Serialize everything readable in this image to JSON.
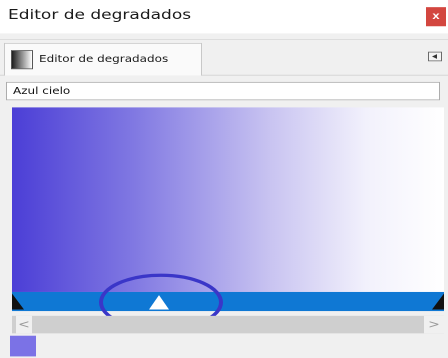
{
  "window": {
    "title": "Editor de degradados",
    "close_label": "x"
  },
  "tab": {
    "label": "Editor de degradados"
  },
  "gradient": {
    "name": "Azul cielo",
    "colors": [
      "#4b3ed6",
      "#8078e2",
      "#c9c4f1",
      "#f2f1fc",
      "#ffffff"
    ],
    "stop_bar_color": "#0f78d4",
    "selected_stop_position": 0.34,
    "selected_color": "#7b72e6"
  },
  "scrollbar": {
    "left_arrow": "<",
    "right_arrow": ">"
  }
}
